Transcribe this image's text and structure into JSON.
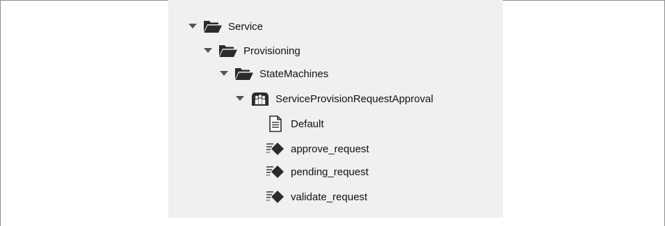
{
  "tree": {
    "nodes": [
      {
        "label": "Service",
        "icon": "folder-open-icon",
        "expanded": true,
        "level": 0
      },
      {
        "label": "Provisioning",
        "icon": "folder-open-icon",
        "expanded": true,
        "level": 1
      },
      {
        "label": "StateMachines",
        "icon": "folder-open-icon",
        "expanded": true,
        "level": 2
      },
      {
        "label": "ServiceProvisionRequestApproval",
        "icon": "class-icon",
        "expanded": true,
        "level": 3
      },
      {
        "label": "Default",
        "icon": "document-icon",
        "level": 4
      },
      {
        "label": "approve_request",
        "icon": "method-icon",
        "level": 4
      },
      {
        "label": "pending_request",
        "icon": "method-icon",
        "level": 4
      },
      {
        "label": "validate_request",
        "icon": "method-icon",
        "level": 4
      }
    ]
  },
  "colors": {
    "panel_background": "#f0f0f0",
    "icon_dark": "#2b2b2b",
    "text": "#111111"
  }
}
